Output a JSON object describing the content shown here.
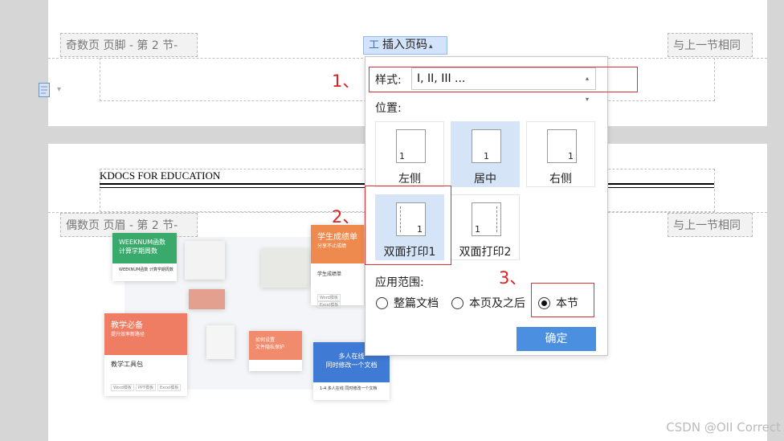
{
  "top_page": {
    "footer_tag": "奇数页 页脚  - 第 2 节-",
    "same_as_prev": "与上一节相同",
    "insert_page_number_button": "插入页码"
  },
  "bottom_page": {
    "header_text": "KDOCS FOR EDUCATION",
    "header_tag": "偶数页 页眉  - 第 2 节-",
    "same_as_prev": "与上一节相同"
  },
  "collage": {
    "card1_title": "WEEKNUM函数",
    "card1_subtitle": "计算学期周数",
    "card1_caption": "WEEKNUM函数 计算学期周数",
    "card2_title": "学生成绩单",
    "card2_subtitle": "分享不止成绩",
    "card2_caption": "学生成绩单",
    "card3_title": "教学必备",
    "card3_subtitle": "提升效率新路径",
    "card3_caption": "教学工具包",
    "card4_title": "多人在线",
    "card4_subtitle": "同时修改一个文档",
    "card4_caption": "1-4 多人在线 同时修改一个文档",
    "card5_title": "如何设置",
    "card5_subtitle": "文件隐私保护",
    "tag_word": "Word模板",
    "tag_ppt": "PPT模板",
    "tag_excel": "Excel模板"
  },
  "popup": {
    "style_label": "样式:",
    "style_value": "I, II, III ...",
    "position_label": "位置:",
    "positions": [
      {
        "label": "左侧",
        "num": "1"
      },
      {
        "label": "居中",
        "num": "1"
      },
      {
        "label": "右侧",
        "num": "1"
      },
      {
        "label": "双面打印1",
        "num": "1"
      },
      {
        "label": "双面打印2",
        "num": "1"
      }
    ],
    "scope_label": "应用范围:",
    "scope_options": [
      "整篇文档",
      "本页及之后",
      "本节"
    ],
    "selected_scope": "本节",
    "ok_button": "确定"
  },
  "annotations": {
    "step1": "1、",
    "step2": "2、",
    "step3": "3、",
    "color": "#e02020"
  },
  "watermark": "CSDN @OII Correct"
}
